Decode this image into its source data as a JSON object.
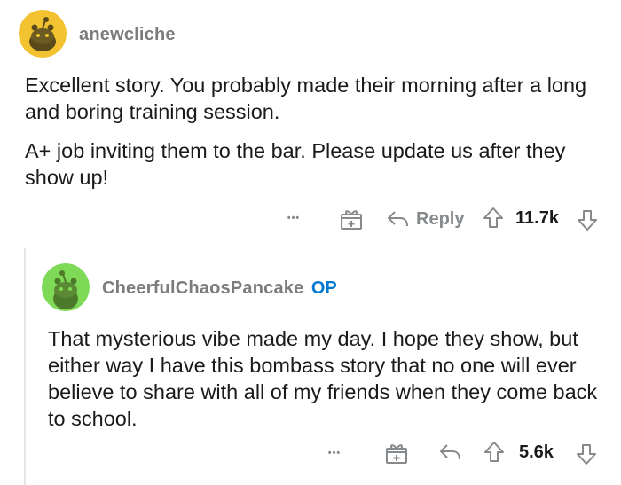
{
  "comment1": {
    "username": "anewcliche",
    "paragraphs": [
      "Excellent story. You probably made their morning after a long and boring training session.",
      "A+ job inviting them to the bar. Please update us after they show up!"
    ],
    "actions": {
      "more": "•••",
      "reply_label": "Reply",
      "score": "11.7k"
    }
  },
  "comment2": {
    "username": "CheerfulChaosPancake",
    "op_badge": "OP",
    "paragraphs": [
      "That mysterious vibe made my day. I hope they show, but either way I have this bombass story that no one will ever believe to share with all of my friends when they come back to school."
    ],
    "actions": {
      "more": "•••",
      "score": "5.6k"
    }
  },
  "colors": {
    "avatar1_bg": "#f2c230",
    "avatar2_bg": "#7ed957",
    "op": "#0079d3",
    "meta": "#878a8c"
  },
  "icons": [
    "snoo-avatar",
    "more-icon",
    "award-icon",
    "reply-icon",
    "upvote-icon",
    "downvote-icon"
  ]
}
